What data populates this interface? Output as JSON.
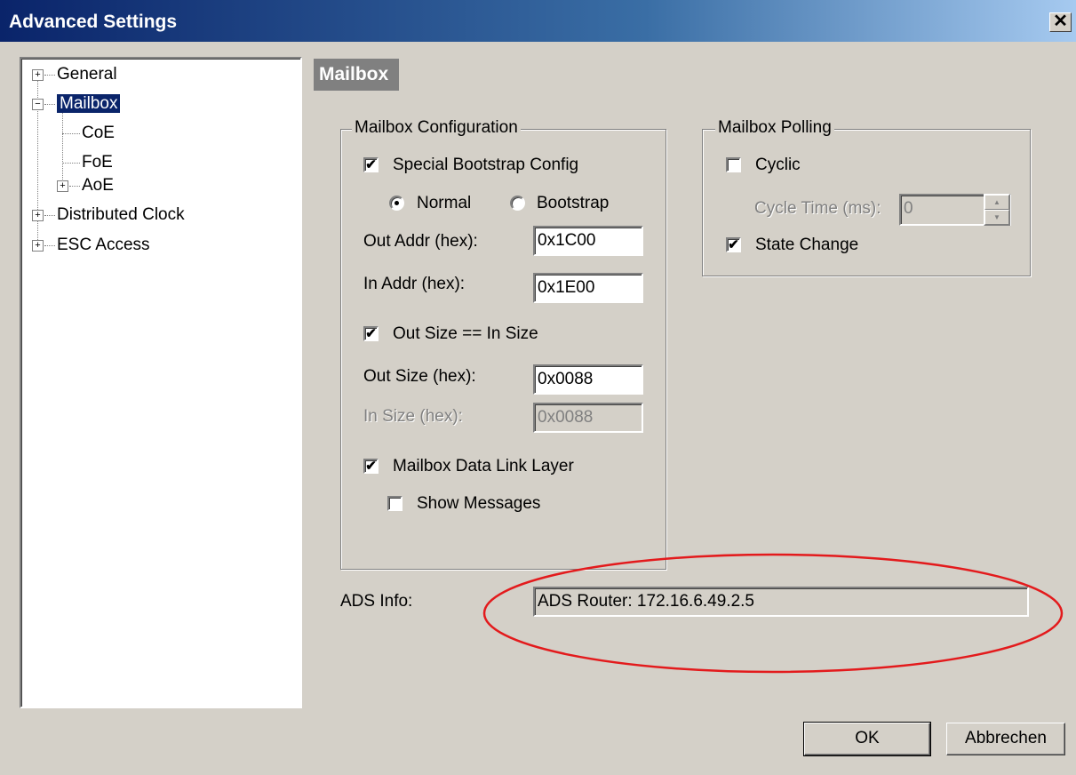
{
  "window": {
    "title": "Advanced Settings",
    "close_glyph": "✕"
  },
  "tree": [
    {
      "label": "General",
      "toggle": "+"
    },
    {
      "label": "Mailbox",
      "toggle": "−",
      "selected": true
    },
    {
      "label": "CoE"
    },
    {
      "label": "FoE"
    },
    {
      "label": "AoE",
      "toggle": "+"
    },
    {
      "label": "Distributed Clock",
      "toggle": "+"
    },
    {
      "label": "ESC Access",
      "toggle": "+"
    }
  ],
  "section_title": "Mailbox",
  "mailbox_config": {
    "legend": "Mailbox Configuration",
    "special_bootstrap": {
      "label": "Special Bootstrap Config",
      "checked": true
    },
    "mode_normal": {
      "label": "Normal",
      "selected": true
    },
    "mode_bootstrap": {
      "label": "Bootstrap",
      "selected": false
    },
    "out_addr": {
      "label": "Out Addr (hex):",
      "value": "0x1C00"
    },
    "in_addr": {
      "label": "In Addr (hex):",
      "value": "0x1E00"
    },
    "same_size": {
      "label": "Out Size == In Size",
      "checked": true
    },
    "out_size": {
      "label": "Out Size (hex):",
      "value": "0x0088"
    },
    "in_size": {
      "label": "In Size (hex):",
      "value": "0x0088"
    },
    "data_link": {
      "label": "Mailbox Data Link Layer",
      "checked": true
    },
    "show_messages": {
      "label": "Show Messages",
      "checked": false
    }
  },
  "mailbox_polling": {
    "legend": "Mailbox Polling",
    "cyclic": {
      "label": "Cyclic",
      "checked": false
    },
    "cycle_time": {
      "label": "Cycle Time (ms):",
      "value": "0"
    },
    "state_change": {
      "label": "State Change",
      "checked": true
    }
  },
  "ads_info": {
    "label": "ADS Info:",
    "value": "ADS Router: 172.16.6.49.2.5"
  },
  "buttons": {
    "ok": "OK",
    "cancel": "Abbrechen"
  },
  "colors": {
    "highlight_ellipse": "#e31a1c",
    "title_bar": "#0a246a",
    "selection": "#0a246a"
  }
}
